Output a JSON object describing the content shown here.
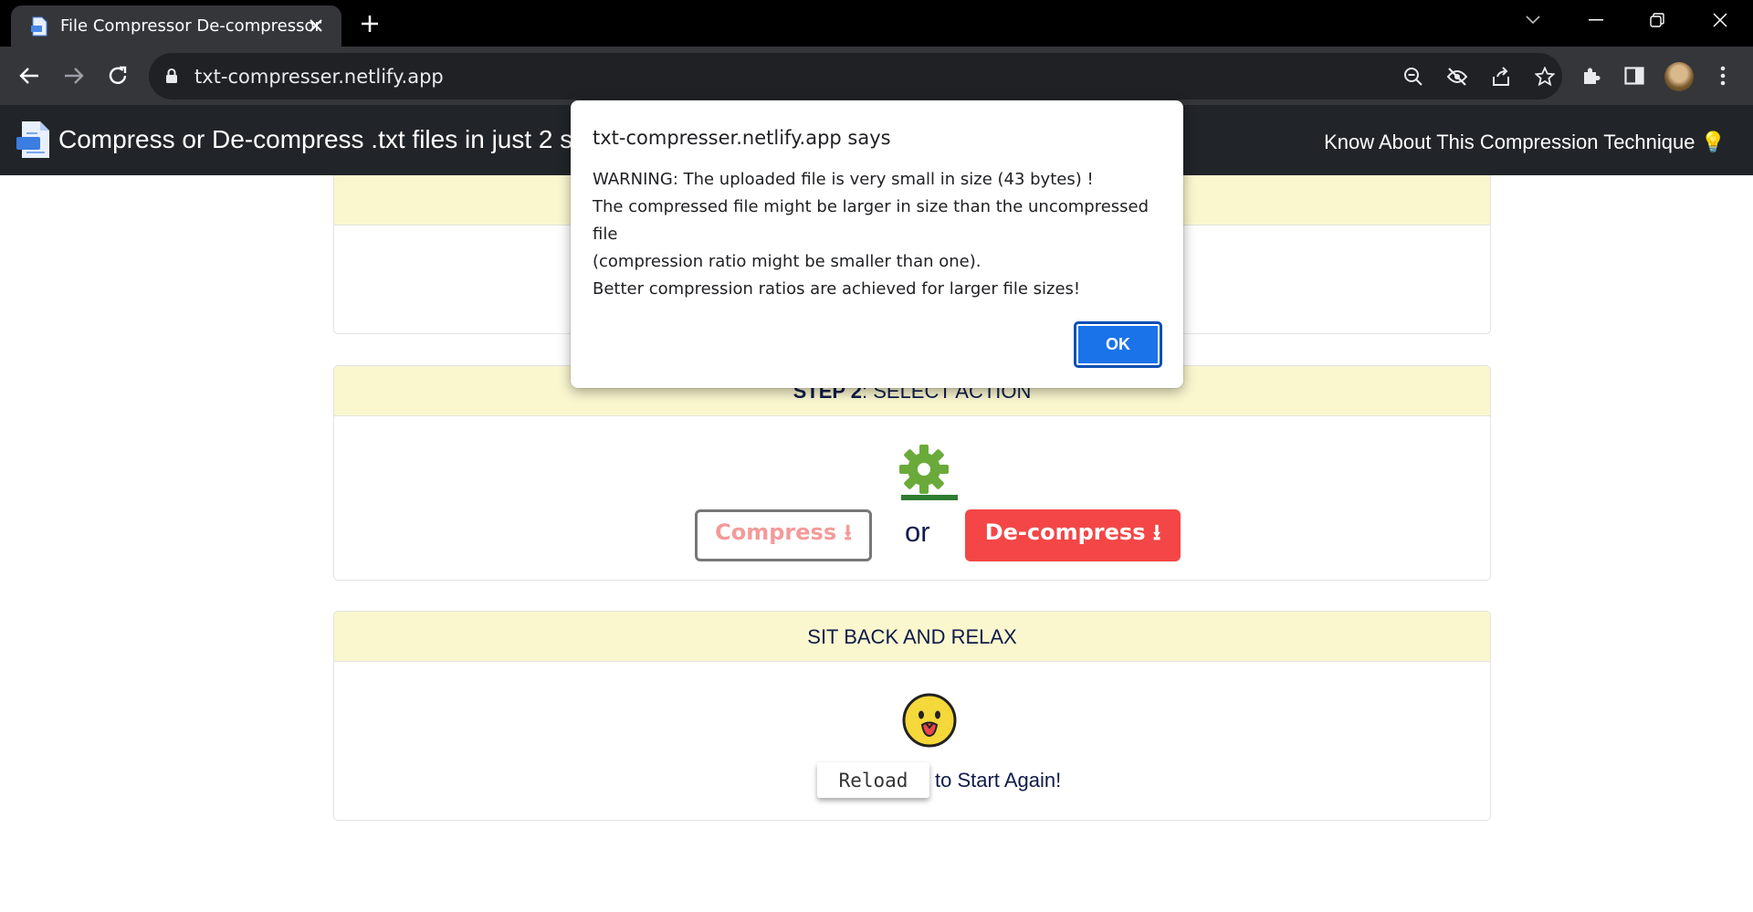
{
  "browser": {
    "tab_title": "File Compressor De-compressor",
    "url": "txt-compresser.netlify.app"
  },
  "navbar": {
    "brand": "Compress or De-compress .txt files in just 2 ste",
    "link": "Know About This Compression Technique 💡"
  },
  "steps": {
    "step2": {
      "header_bold": "STEP 2",
      "header_rest": ": SELECT ACTION"
    },
    "compress_label": "Compress ⭳",
    "or_label": "or",
    "decompress_label": "De-compress ⭳",
    "step3": {
      "header": "SIT BACK AND RELAX"
    },
    "reload_label": "Reload",
    "reload_suffix": "to Start Again!"
  },
  "dialog": {
    "title": "txt-compresser.netlify.app says",
    "lines": [
      "WARNING: The uploaded file is very small in size (43 bytes) !",
      "The compressed file might be larger in size than the uncompressed file",
      "(compression ratio might be smaller than one).",
      "Better compression ratios are achieved for larger file sizes!"
    ],
    "ok_label": "OK"
  },
  "colors": {
    "navbar_bg": "#212529",
    "card_header_bg": "#faf7cf",
    "decompress_bg": "#f44646",
    "compress_text": "#f49a9a",
    "gear_green": "#6aaa3a",
    "ok_blue": "#1a73e8"
  }
}
